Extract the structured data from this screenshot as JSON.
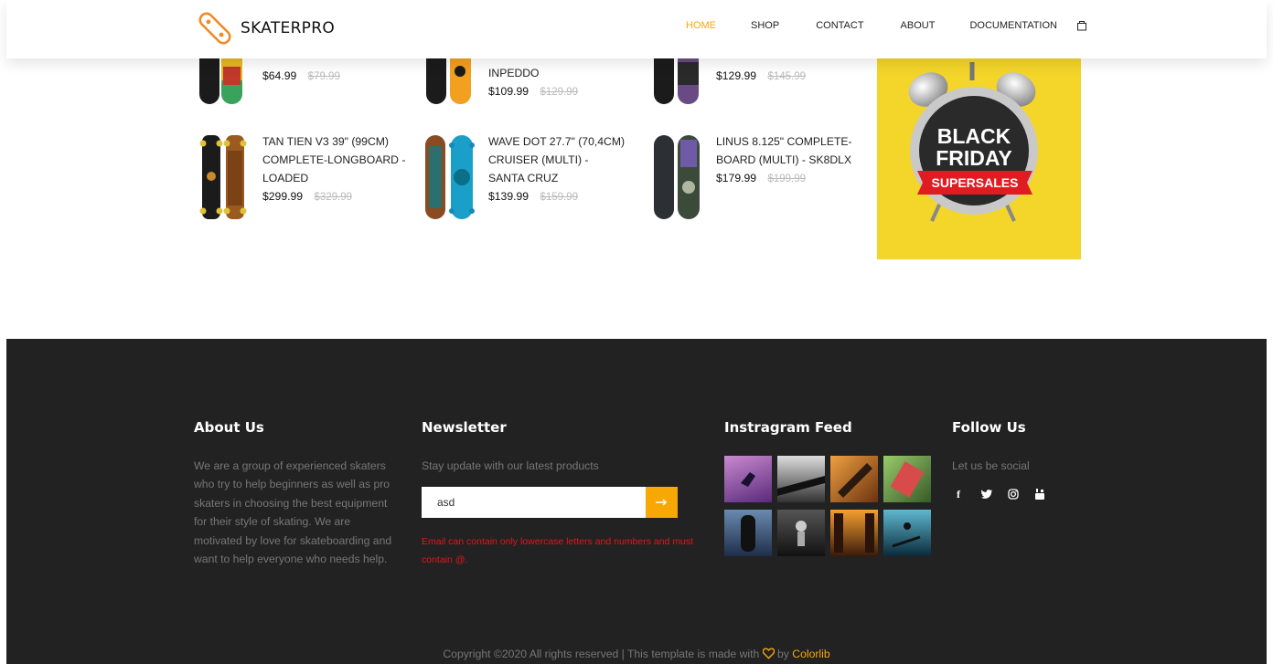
{
  "header": {
    "brand": "SKATERPRO",
    "nav": [
      "HOME",
      "SHOP",
      "CONTACT",
      "ABOUT",
      "DOCUMENTATION"
    ]
  },
  "products": [
    {
      "title": "",
      "price": "$64.99",
      "old": "$79.99"
    },
    {
      "title": "INPEDDO",
      "price": "$109.99",
      "old": "$129.99"
    },
    {
      "title": "",
      "price": "$129.99",
      "old": "$145.99"
    },
    {
      "title": "TAN TIEN V3 39\" (99CM) COMPLETE-LONGBOARD - LOADED",
      "price": "$299.99",
      "old": "$329.99"
    },
    {
      "title": "WAVE DOT 27.7\" (70,4CM) CRUISER (MULTI) - SANTA CRUZ",
      "price": "$139.99",
      "old": "$159.99"
    },
    {
      "title": "LINUS 8.125\" COMPLETE-BOARD (MULTI) - SK8DLX",
      "price": "$179.99",
      "old": "$199.99"
    }
  ],
  "banner": {
    "line1": "BLACK",
    "line2": "FRIDAY",
    "ribbon": "SUPERSALES"
  },
  "footer": {
    "about_title": "About Us",
    "about_text": "We are a group of experienced skaters who try to help beginners as well as pro skaters in choosing the best equipment for their style of skating. We are motivated by love for skateboarding and want to help everyone who needs help.",
    "news_title": "Newsletter",
    "news_text": "Stay update with our latest products",
    "news_value": "asd",
    "news_error": "Email can contain only lowercase letters and numbers and must contain @.",
    "insta_title": "Instragram Feed",
    "follow_title": "Follow Us",
    "follow_text": "Let us be social",
    "copyright_pre": "Copyright ©2020 All rights reserved | This template is made with",
    "copyright_by": "by",
    "copyright_link": "Colorlib"
  },
  "colors": {
    "accent": "#f8a805",
    "footer_bg": "#222222",
    "error": "#e5141e"
  }
}
